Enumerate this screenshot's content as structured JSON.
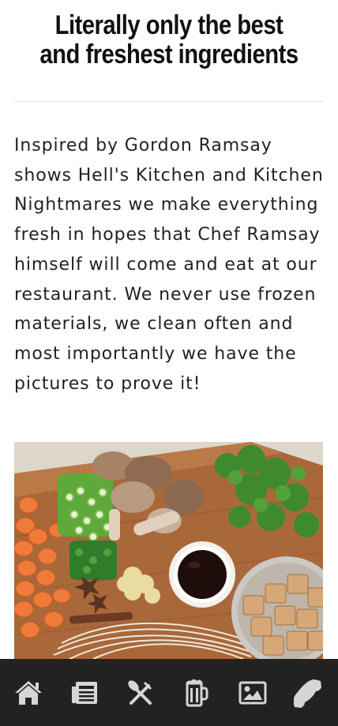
{
  "headline": "Literally only the best and freshest ingredients",
  "body": "Inspired by Gordon Ramsay shows Hell's Kitchen and Kitchen Nightmares we make everything fresh in hopes that Chef Ramsay himself will come and eat at our restaurant. We never use frozen materials, we clean often and most importantly we have the pictures to prove it!",
  "photo": {
    "subject": "ingredients-on-cutting-board"
  },
  "nav": {
    "background_color": "#222222",
    "icon_color": "#d6d6d6",
    "items": [
      {
        "icon": "home-icon"
      },
      {
        "icon": "newspaper-icon"
      },
      {
        "icon": "utensils-icon"
      },
      {
        "icon": "beer-mug-icon"
      },
      {
        "icon": "image-icon"
      },
      {
        "icon": "phone-icon"
      }
    ]
  }
}
